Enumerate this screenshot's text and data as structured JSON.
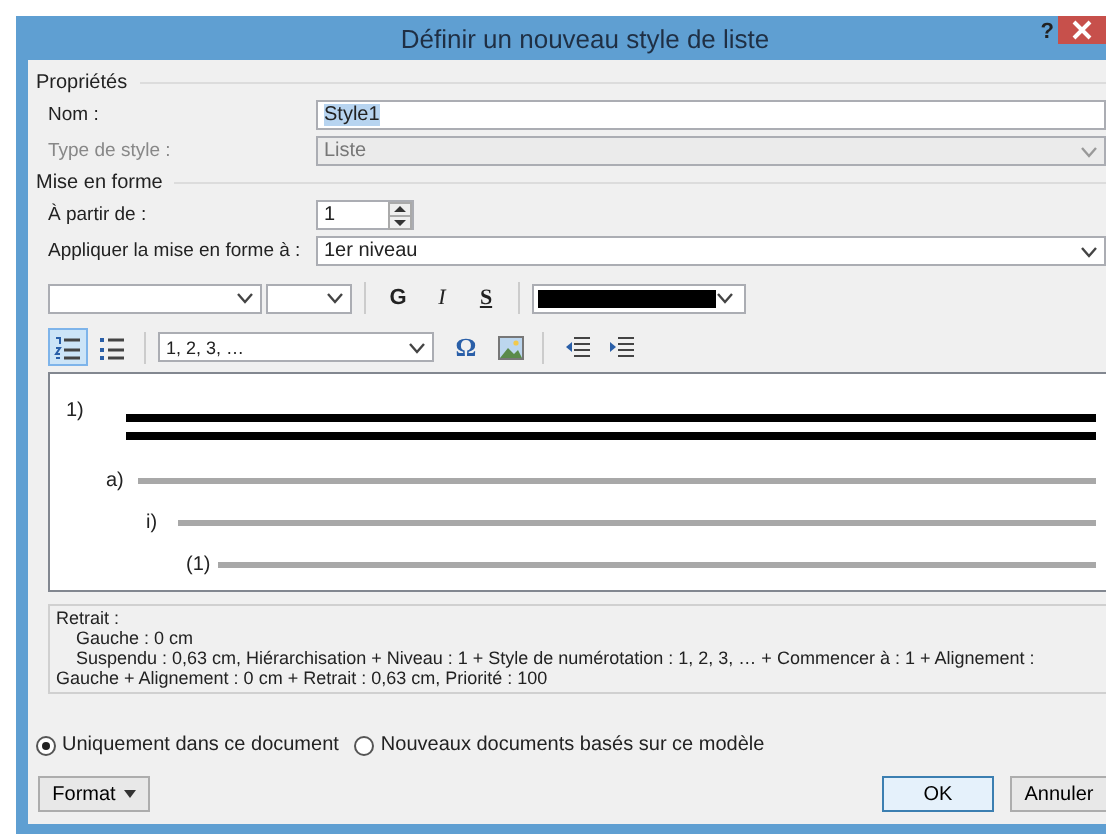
{
  "window": {
    "title": "Définir un nouveau style de liste",
    "help": "?"
  },
  "properties": {
    "heading": "Propriétés",
    "name": {
      "label": "Nom :",
      "value": "Style1"
    },
    "style_type": {
      "label": "Type de style :",
      "value": "Liste",
      "disabled": true
    }
  },
  "formatting": {
    "heading": "Mise en forme",
    "start_at": {
      "label": "À partir de :",
      "value": "1"
    },
    "apply_to": {
      "label": "Appliquer la mise en forme à :",
      "value": "1er niveau"
    }
  },
  "font_toolbar": {
    "bold": "G",
    "italic": "I",
    "underline": "S"
  },
  "list_toolbar": {
    "list_buttons": [
      {
        "kind": "numbered",
        "selected": true
      },
      {
        "kind": "bulleted",
        "selected": false
      }
    ],
    "numbering_style": "1, 2, 3, …",
    "symbol": "Ω"
  },
  "preview": {
    "levels": [
      {
        "marker": "1)",
        "selected": true
      },
      {
        "marker": "a)",
        "selected": false
      },
      {
        "marker": "i)",
        "selected": false
      },
      {
        "marker": "(1)",
        "selected": false
      }
    ]
  },
  "description": [
    {
      "kind": "plain",
      "text": "Retrait :"
    },
    {
      "kind": "indent",
      "text": "Gauche :  0 cm"
    },
    {
      "kind": "hanging",
      "text": "Suspendu : 0,63 cm, Hiérarchisation + Niveau : 1 + Style de numérotation : 1, 2, 3, … + Commencer à : 1 + Alignement : Gauche + Alignement :  0 cm + Retrait :  0,63 cm, Priorité : 100"
    }
  ],
  "scope": [
    {
      "label": "Uniquement dans ce document",
      "selected": true
    },
    {
      "label": "Nouveaux documents basés sur ce modèle",
      "selected": false
    }
  ],
  "buttons": {
    "format": "Format",
    "ok": "OK",
    "cancel": "Annuler"
  }
}
